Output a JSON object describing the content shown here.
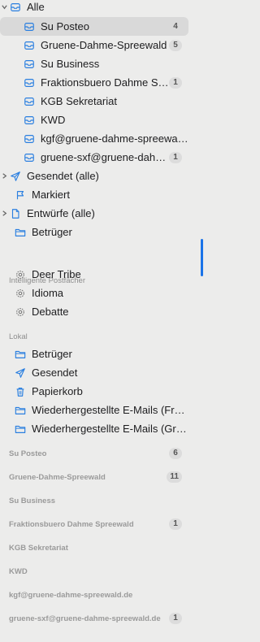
{
  "colors": {
    "accent": "#2a7fe0",
    "selected_bg": "#d9d9d9",
    "badge_bg": "#dcdcdc"
  },
  "top": {
    "label": "Alle",
    "icon": "inbox-stack-icon"
  },
  "inboxes": [
    {
      "label": "Su Posteo",
      "badge": "4",
      "selected": true
    },
    {
      "label": "Gruene-Dahme-Spreewald",
      "badge": "5"
    },
    {
      "label": "Su Business",
      "badge": ""
    },
    {
      "label": "Fraktionsbuero Dahme Spree...",
      "badge": "1"
    },
    {
      "label": "KGB Sekretariat",
      "badge": ""
    },
    {
      "label": "KWD",
      "badge": ""
    },
    {
      "label": "kgf@gruene-dahme-spreewald.de",
      "badge": ""
    },
    {
      "label": "gruene-sxf@gruene-dahme-...",
      "badge": "1"
    }
  ],
  "mailboxes": [
    {
      "label": "Gesendet (alle)",
      "icon": "paper-plane-icon",
      "chevron": true
    },
    {
      "label": "Markiert",
      "icon": "flag-icon",
      "chevron": false
    },
    {
      "label": "Entwürfe (alle)",
      "icon": "document-icon",
      "chevron": true
    },
    {
      "label": "Betrüger",
      "icon": "folder-icon",
      "chevron": false
    }
  ],
  "smart_section": {
    "title": "Intelligente Postfächer"
  },
  "smart": [
    {
      "label": "Deer Tribe",
      "icon": "gear-icon"
    },
    {
      "label": "Idioma",
      "icon": "gear-icon"
    },
    {
      "label": "Debatte",
      "icon": "gear-icon"
    }
  ],
  "local_section": {
    "title": "Lokal"
  },
  "local": [
    {
      "label": "Betrüger",
      "icon": "folder-icon"
    },
    {
      "label": "Gesendet",
      "icon": "paper-plane-icon"
    },
    {
      "label": "Papierkorb",
      "icon": "trash-icon"
    },
    {
      "label": "Wiederhergestellte E-Mails (Fraktio...",
      "icon": "folder-icon"
    },
    {
      "label": "Wiederhergestellte E-Mails (Gruene...",
      "icon": "folder-icon"
    }
  ],
  "accounts": [
    {
      "label": "Su Posteo",
      "badge": "6"
    },
    {
      "label": "Gruene-Dahme-Spreewald",
      "badge": "11"
    },
    {
      "label": "Su Business",
      "badge": ""
    },
    {
      "label": "Fraktionsbuero Dahme Spreewald",
      "badge": "1"
    },
    {
      "label": "KGB Sekretariat",
      "badge": ""
    },
    {
      "label": "KWD",
      "badge": ""
    },
    {
      "label": "kgf@gruene-dahme-spreewald.de",
      "badge": ""
    },
    {
      "label": "gruene-sxf@gruene-dahme-spreewald.de",
      "badge": "1"
    }
  ]
}
